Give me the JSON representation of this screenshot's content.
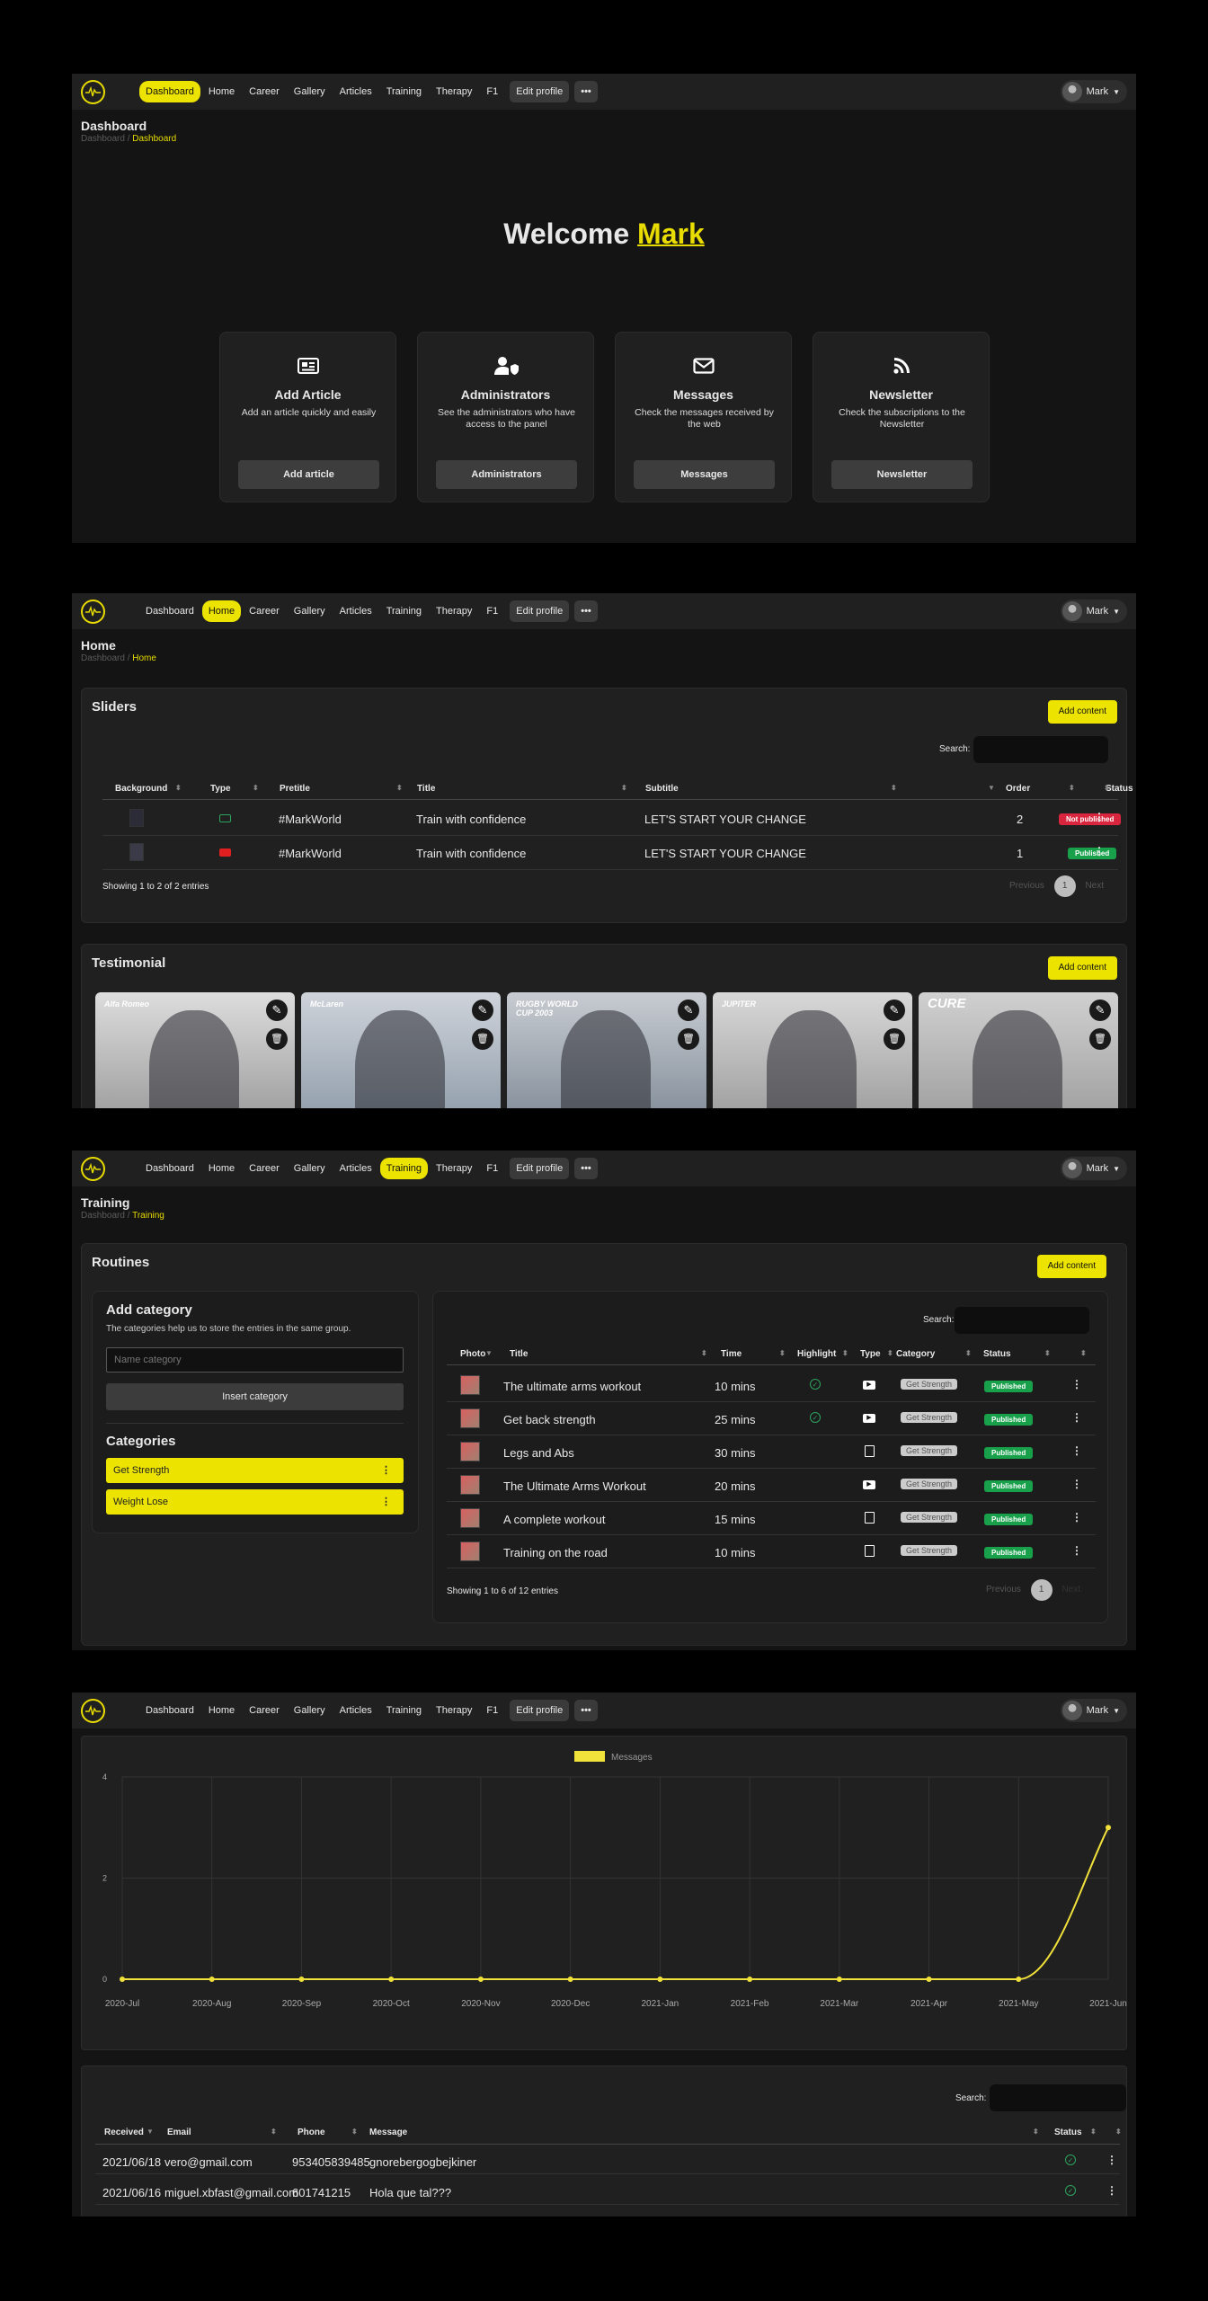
{
  "nav": {
    "items": [
      "Dashboard",
      "Home",
      "Career",
      "Gallery",
      "Articles",
      "Training",
      "Therapy",
      "F1"
    ],
    "edit_profile": "Edit profile",
    "more": "•••",
    "user_name": "Mark"
  },
  "breadcrumb_root": "Dashboard",
  "breadcrumb_sep": "/",
  "dashboard": {
    "title": "Dashboard",
    "welcome": "Welcome",
    "welcome_name": "Mark",
    "cards": [
      {
        "title": "Add Article",
        "desc": "Add an article quickly and easily",
        "button": "Add article",
        "icon": "newspaper-icon"
      },
      {
        "title": "Administrators",
        "desc": "See the administrators who have access to the panel",
        "button": "Administrators",
        "icon": "user-shield-icon"
      },
      {
        "title": "Messages",
        "desc": "Check the messages received by the web",
        "button": "Messages",
        "icon": "envelope-icon"
      },
      {
        "title": "Newsletter",
        "desc": "Check the subscriptions to the Newsletter",
        "button": "Newsletter",
        "icon": "rss-icon"
      }
    ]
  },
  "home": {
    "title": "Home",
    "sliders": {
      "title": "Sliders",
      "add_button": "Add content",
      "search_label": "Search:",
      "headers": [
        "Background",
        "Type",
        "Pretitle",
        "Title",
        "Subtitle",
        "Order",
        "Status"
      ],
      "rows": [
        {
          "pretitle": "#MarkWorld",
          "title": "Train with confidence",
          "subtitle": "LET'S START YOUR CHANGE",
          "order": "2",
          "status": "Not published"
        },
        {
          "pretitle": "#MarkWorld",
          "title": "Train with confidence",
          "subtitle": "LET'S START YOUR CHANGE",
          "order": "1",
          "status": "Published"
        }
      ],
      "showing": "Showing 1 to 2 of 2 entries",
      "previous": "Previous",
      "page": "1",
      "next": "Next"
    },
    "testimonial": {
      "title": "Testimonial",
      "add_button": "Add content",
      "cards": [
        "Alfa Romeo",
        "McLaren",
        "RUGBY WORLD CUP 2003",
        "JUPITER",
        "CURE"
      ]
    }
  },
  "training": {
    "title": "Training",
    "routines_title": "Routines",
    "add_button": "Add content",
    "add_category": {
      "title": "Add category",
      "desc": "The categories help us to store the entries in the same group.",
      "placeholder": "Name category",
      "button": "Insert category"
    },
    "categories_title": "Categories",
    "categories": [
      "Get Strength",
      "Weight Lose"
    ],
    "search_label": "Search:",
    "headers": [
      "Photo",
      "Title",
      "Time",
      "Highlight",
      "Type",
      "Category",
      "Status"
    ],
    "rows": [
      {
        "title": "The ultimate arms workout",
        "time": "10 mins",
        "highlight": true,
        "type": "video",
        "category": "Get Strength",
        "status": "Published"
      },
      {
        "title": "Get back strength",
        "time": "25 mins",
        "highlight": true,
        "type": "video",
        "category": "Get Strength",
        "status": "Published"
      },
      {
        "title": "Legs and Abs",
        "time": "30 mins",
        "highlight": false,
        "type": "doc",
        "category": "Get Strength",
        "status": "Published"
      },
      {
        "title": "The Ultimate Arms Workout",
        "time": "20 mins",
        "highlight": false,
        "type": "video",
        "category": "Get Strength",
        "status": "Published"
      },
      {
        "title": "A complete workout",
        "time": "15 mins",
        "highlight": false,
        "type": "doc",
        "category": "Get Strength",
        "status": "Published"
      },
      {
        "title": "Training on the road",
        "time": "10 mins",
        "highlight": false,
        "type": "doc",
        "category": "Get Strength",
        "status": "Published"
      }
    ],
    "showing": "Showing 1 to 6 of 12 entries",
    "previous": "Previous",
    "page": "1"
  },
  "messages": {
    "chart_data": {
      "type": "line",
      "series": [
        {
          "name": "Messages",
          "values": [
            0,
            0,
            0,
            0,
            0,
            0,
            0,
            0,
            0,
            0,
            0,
            3
          ]
        }
      ],
      "categories": [
        "2020-Jul",
        "2020-Aug",
        "2020-Sep",
        "2020-Oct",
        "2020-Nov",
        "2020-Dec",
        "2021-Jan",
        "2021-Feb",
        "2021-Mar",
        "2021-Apr",
        "2021-May",
        "2021-Jun"
      ],
      "yticks": [
        "0",
        "2",
        "4"
      ],
      "ylim": [
        0,
        4
      ],
      "grid": true,
      "legend": "top-center",
      "color": "#f1e13b"
    },
    "search_label": "Search:",
    "headers": [
      "Received",
      "Email",
      "Phone",
      "Message",
      "Status"
    ],
    "rows": [
      {
        "received": "2021/06/18",
        "email": "vero@gmail.com",
        "phone": "953405839485",
        "message": "gnorebergogbejkiner"
      },
      {
        "received": "2021/06/16",
        "email": "miguel.xbfast@gmail.com",
        "phone": "601741215",
        "message": "Hola que tal???"
      }
    ]
  }
}
